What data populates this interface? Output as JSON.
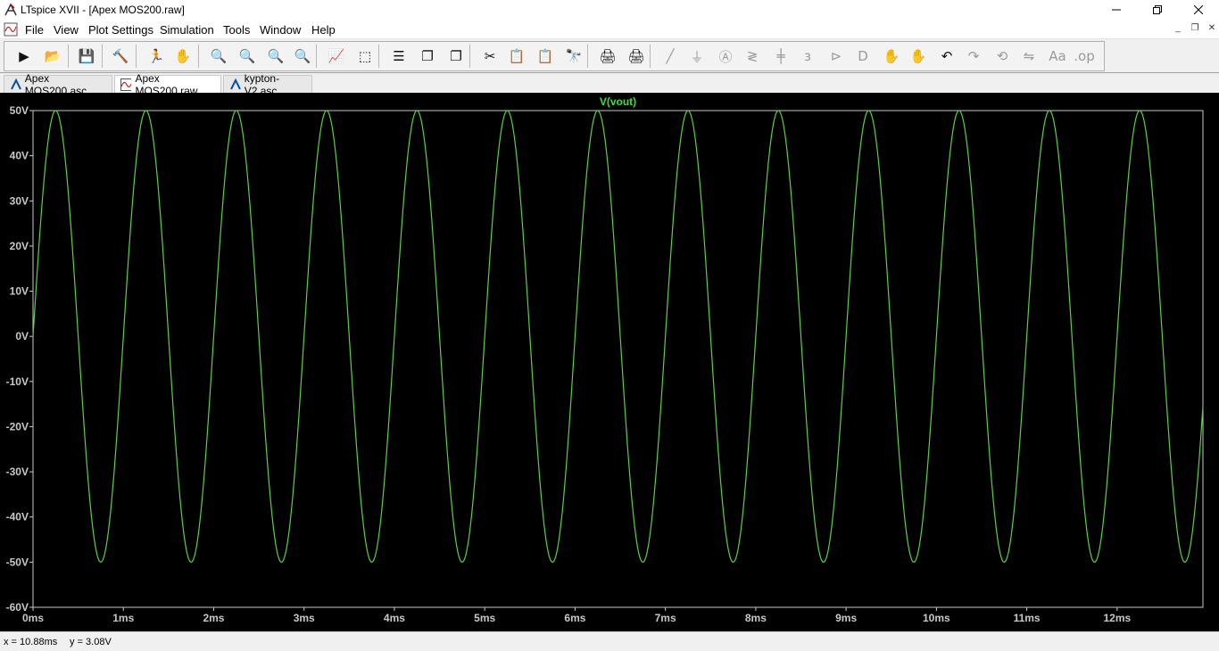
{
  "window": {
    "title": "LTspice XVII - [Apex MOS200.raw]",
    "controls": [
      "minimize-icon",
      "maximize-icon",
      "close-icon"
    ]
  },
  "menu": {
    "items": [
      "File",
      "View",
      "Plot Settings",
      "Simulation",
      "Tools",
      "Window",
      "Help"
    ]
  },
  "toolbar": {
    "buttons": [
      "run-icon",
      "open-icon",
      "save-icon",
      "control-panel-icon",
      "run-man-icon",
      "pan-hand-icon",
      "zoom-in-icon",
      "zoom-full-icon",
      "zoom-out-icon",
      "zoom-cancel-icon",
      "autorange-icon",
      "fit-icon",
      "tile-horizontal-icon",
      "cascade-icon",
      "tile-vertical-icon",
      "cut-icon",
      "copy-icon",
      "paste-icon",
      "find-icon",
      "print-icon",
      "print-setup-icon",
      "wire-icon",
      "ground-icon",
      "label-icon",
      "resistor-icon",
      "capacitor-icon",
      "inductor-icon",
      "diode-icon",
      "component-icon",
      "move-icon",
      "drag-icon",
      "undo-icon",
      "redo-icon",
      "rotate-icon",
      "mirror-icon",
      "text-icon",
      "spice-directive-icon"
    ]
  },
  "tabs": [
    {
      "label": "Apex MOS200.asc",
      "icon": "schematic-icon",
      "active": false
    },
    {
      "label": "Apex MOS200.raw",
      "icon": "waveform-icon",
      "active": true
    },
    {
      "label": "kypton-V2.asc",
      "icon": "schematic-icon",
      "active": false
    }
  ],
  "colors": {
    "trace": "#55d43c",
    "trace_label": "#3ee03e",
    "axes": "#c8c8c8",
    "background": "#000000"
  },
  "chart_data": {
    "type": "line",
    "title": "V(vout)",
    "series": [
      {
        "name": "V(vout)",
        "waveform": "sine",
        "amplitude": 50,
        "offset": 0,
        "frequency_hz": 1000,
        "phase_deg": 0,
        "x_range": [
          0,
          12.95
        ]
      }
    ],
    "x": [
      0,
      0.25,
      0.5,
      0.75,
      1.0,
      1.25,
      1.5,
      1.75,
      2.0,
      2.25,
      2.5,
      2.75,
      3.0,
      3.25,
      3.5,
      3.75,
      4.0,
      4.25,
      4.5,
      4.75,
      5.0,
      5.25,
      5.5,
      5.75,
      6.0,
      6.25,
      6.5,
      6.75,
      7.0,
      7.25,
      7.5,
      7.75,
      8.0,
      8.25,
      8.5,
      8.75,
      9.0,
      9.25,
      9.5,
      9.75,
      10.0,
      10.25,
      10.5,
      10.75,
      11.0,
      11.25,
      11.5,
      11.75,
      12.0,
      12.25,
      12.5,
      12.75,
      12.95
    ],
    "y": [
      0,
      50,
      0,
      -50,
      0,
      50,
      0,
      -50,
      0,
      50,
      0,
      -50,
      0,
      50,
      0,
      -50,
      0,
      50,
      0,
      -50,
      0,
      50,
      0,
      -50,
      0,
      50,
      0,
      -50,
      0,
      50,
      0,
      -50,
      0,
      50,
      0,
      -50,
      0,
      50,
      0,
      -50,
      0,
      50,
      0,
      -50,
      0,
      50,
      0,
      -50,
      0,
      50,
      0,
      -50,
      -15
    ],
    "xlim": [
      0,
      12.95
    ],
    "ylim": [
      -60,
      50
    ],
    "xticks": [
      "0ms",
      "1ms",
      "2ms",
      "3ms",
      "4ms",
      "5ms",
      "6ms",
      "7ms",
      "8ms",
      "9ms",
      "10ms",
      "11ms",
      "12ms"
    ],
    "yticks": [
      "50V",
      "40V",
      "30V",
      "20V",
      "10V",
      "0V",
      "-10V",
      "-20V",
      "-30V",
      "-40V",
      "-50V",
      "-60V"
    ],
    "grid": false,
    "xlabel": "",
    "ylabel": ""
  },
  "status": {
    "x_readout": "x = 10.88ms",
    "y_readout": "y = 3.08V"
  }
}
